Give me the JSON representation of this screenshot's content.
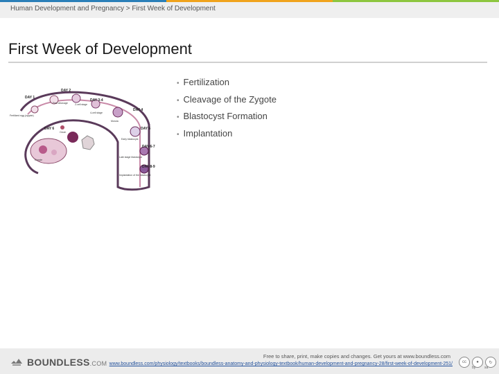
{
  "header": {
    "breadcrumb": "Human Development and Pregnancy > First Week of Development",
    "stripe_colors": [
      "#2b7fb8",
      "#f0a31c",
      "#8dc63f"
    ]
  },
  "slide": {
    "title": "First Week of Development",
    "bullets": [
      "Fertilization",
      "Cleavage of the Zygote",
      "Blastocyst Formation",
      "Implantation"
    ]
  },
  "diagram": {
    "labels": {
      "day1": "DAY 1",
      "day2": "DAY 2",
      "day34": "DAY 3-4",
      "day4": "DAY 4",
      "day5": "DAY 5",
      "day6": "DAY 6",
      "day67": "DAY 6-7",
      "day89": "DAY 8-9",
      "first_cleavage": "First cleavage",
      "two_cell": "2-cell stage",
      "four_cell": "4-cell stage",
      "morula": "Morula",
      "early_blast": "Early blastocyst",
      "late_blast": "Late stage blastocyst",
      "implant": "Implantation of the blastocyst",
      "ovum": "Ovum",
      "fertilized": "Fertilized egg (zygote)",
      "oocyte": "Oocyte"
    }
  },
  "footer": {
    "brand": "BOUNDLESS",
    "brand_suffix": ".COM",
    "notice": "Free to share, print, make copies and changes. Get yours at www.boundless.com",
    "source": "www.boundless.com/physiology/textbooks/boundless-anatomy-and-physiology-textbook/human-development-and-pregnancy-28/first-week-of-development-251/",
    "license": [
      "cc",
      "by",
      "sa"
    ]
  }
}
